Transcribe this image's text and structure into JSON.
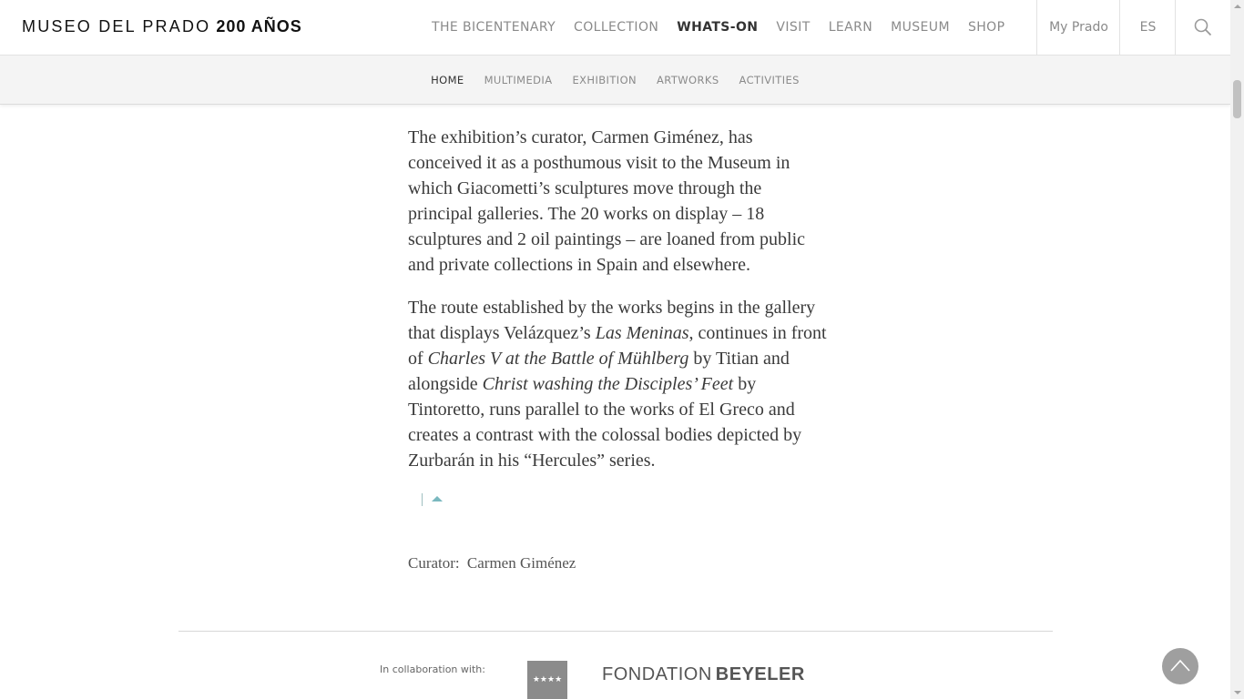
{
  "header": {
    "logo_text": "MUSEO DEL PRADO",
    "logo_strong": "200 AÑOS",
    "nav": [
      {
        "label": "THE BICENTENARY"
      },
      {
        "label": "COLLECTION"
      },
      {
        "label": "WHATS-ON"
      },
      {
        "label": "VISIT"
      },
      {
        "label": "LEARN"
      },
      {
        "label": "MUSEUM"
      },
      {
        "label": "SHOP"
      }
    ],
    "active_nav": "WHATS-ON",
    "my_prado": "My Prado",
    "language": "ES",
    "search_icon": "search-icon"
  },
  "subnav": {
    "items": [
      {
        "label": "HOME"
      },
      {
        "label": "MULTIMEDIA"
      },
      {
        "label": "EXHIBITION"
      },
      {
        "label": "ARTWORKS"
      },
      {
        "label": "ACTIVITIES"
      }
    ],
    "active": "HOME"
  },
  "article": {
    "p1": "The exhibition’s curator, Carmen Giménez, has conceived it as a posthumous visit to the Museum in which Giacometti’s sculptures move through the principal galleries. The 20 works on display – 18 sculptures and 2 oil paintings – are loaned from public and private collections in Spain and elsewhere.",
    "p2_a": "The route established by the works begins in the gallery that displays Velázquez’s ",
    "p2_em1": "Las Meninas",
    "p2_b": ", continues in front of ",
    "p2_em2": "Charles V at the Battle of Mühlberg",
    "p2_c": " by Titian and alongside ",
    "p2_em3": "Christ washing the Disciples’ Feet",
    "p2_d": " by Tintoretto, runs parallel to the works of El Greco and creates a contrast with the colossal bodies depicted by Zurbarán in his “Hercules” series."
  },
  "curator": {
    "label": "Curator:",
    "name": "Carmen Giménez"
  },
  "footer": {
    "collab_label": "In collaboration with:",
    "partner_2a": "FONDATION",
    "partner_2b": "BEYELER",
    "stars": "★★★★"
  },
  "colors": {
    "accent_teal": "#7ab8bf",
    "text": "#3a3a3a",
    "nav_muted": "#8a8a8a"
  }
}
